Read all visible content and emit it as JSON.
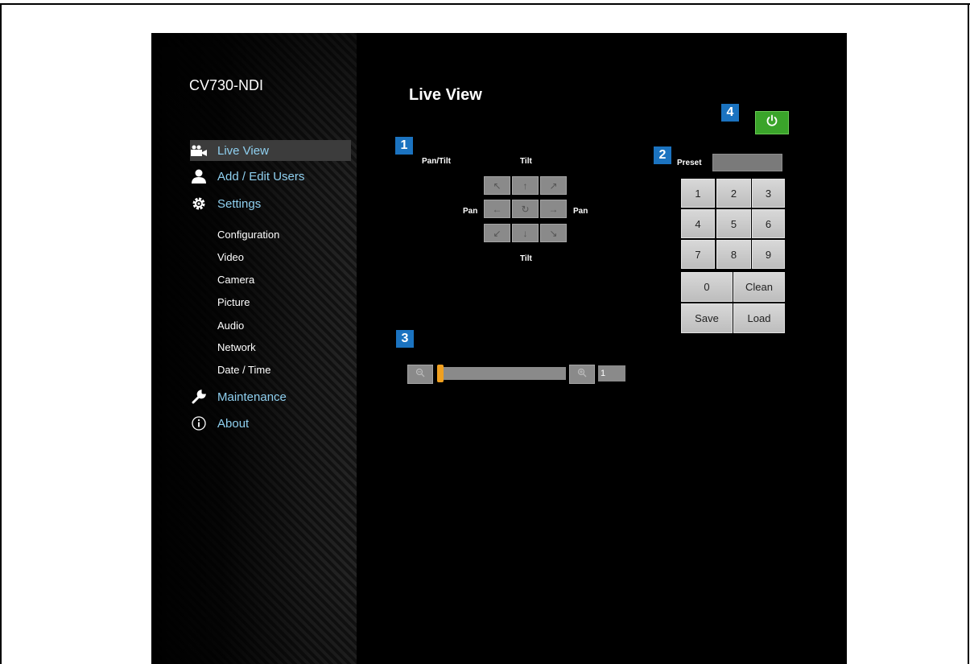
{
  "app": {
    "title": "CV730-NDI"
  },
  "sidebar": {
    "items": [
      {
        "label": "Live View",
        "icon": "video-camera-icon"
      },
      {
        "label": "Add / Edit Users",
        "icon": "user-icon"
      },
      {
        "label": "Settings",
        "icon": "gear-icon"
      },
      {
        "label": "Maintenance",
        "icon": "wrench-icon"
      },
      {
        "label": "About",
        "icon": "info-icon"
      }
    ],
    "sub_items": [
      "Configuration",
      "Video",
      "Camera",
      "Picture",
      "Audio",
      "Network",
      "Date / Time"
    ]
  },
  "main": {
    "title": "Live View",
    "badges": [
      "1",
      "2",
      "3",
      "4"
    ],
    "ptz": {
      "pan_tilt_label": "Pan/Tilt",
      "tilt_top": "Tilt",
      "tilt_bottom": "Tilt",
      "pan_left": "Pan",
      "pan_right": "Pan"
    },
    "preset": {
      "label": "Preset",
      "value": "",
      "keys": [
        "1",
        "2",
        "3",
        "4",
        "5",
        "6",
        "7",
        "8",
        "9",
        "0",
        "Clean",
        "Save",
        "Load"
      ]
    },
    "zoom": {
      "value": "1"
    }
  },
  "colors": {
    "accent_link": "#8fd0f0",
    "badge": "#1b73c0",
    "power": "#3aa42a",
    "zoom_handle": "#f0a020"
  }
}
